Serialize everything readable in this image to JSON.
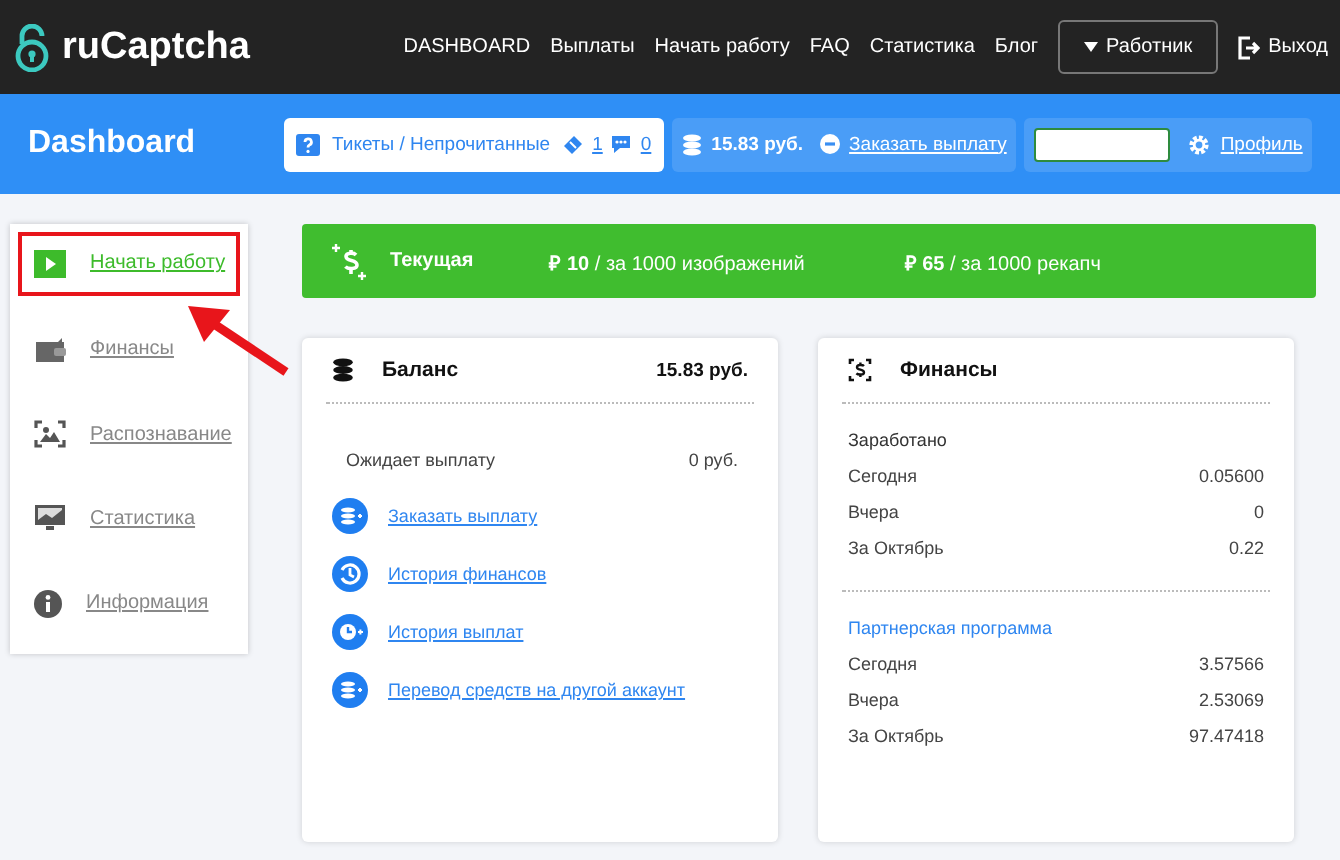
{
  "brand": "ruCaptcha",
  "nav": [
    "DASHBOARD",
    "Выплаты",
    "Начать работу",
    "FAQ",
    "Статистика",
    "Блог"
  ],
  "role_button": "Работник",
  "logout": "Выход",
  "page_title": "Dashboard",
  "tickets": {
    "label": "Тикеты / Непрочитанные",
    "tickets_count": "1",
    "messages_count": "0"
  },
  "balance_box": {
    "amount": "15.83 руб.",
    "link": "Заказать выплату"
  },
  "profile": {
    "link": "Профиль"
  },
  "sidebar": {
    "items": [
      {
        "label": "Начать работу",
        "kind": "play",
        "selected": true
      },
      {
        "label": "Финансы",
        "kind": "wallet",
        "selected": false
      },
      {
        "label": "Распознавание",
        "kind": "recognize",
        "selected": false
      },
      {
        "label": "Статистика",
        "kind": "monitor",
        "selected": false
      },
      {
        "label": "Информация",
        "kind": "info",
        "selected": false
      }
    ]
  },
  "rate_banner": {
    "title": "Текущая",
    "rates": [
      {
        "price": "₽ 10",
        "unit": "/ за 1000 изображений"
      },
      {
        "price": "₽ 65",
        "unit": "/ за 1000 рекапч"
      }
    ]
  },
  "balance_card": {
    "title": "Баланс",
    "amount": "15.83 руб.",
    "pending_label": "Ожидает выплату",
    "pending_value": "0 руб.",
    "links": [
      {
        "label": "Заказать выплату",
        "kind": "coins"
      },
      {
        "label": "История финансов",
        "kind": "history"
      },
      {
        "label": "История выплат",
        "kind": "clock"
      },
      {
        "label": "Перевод средств на другой аккаунт",
        "kind": "coins"
      }
    ]
  },
  "finance_card": {
    "title": "Финансы",
    "sections": [
      {
        "heading": "Заработано",
        "kind": "plain",
        "rows": [
          {
            "label": "Сегодня",
            "value": "0.05600"
          },
          {
            "label": "Вчера",
            "value": "0"
          },
          {
            "label": "За Октябрь",
            "value": "0.22"
          }
        ]
      },
      {
        "heading": "Партнерская программа",
        "kind": "link",
        "rows": [
          {
            "label": "Сегодня",
            "value": "3.57566"
          },
          {
            "label": "Вчера",
            "value": "2.53069"
          },
          {
            "label": "За Октябрь",
            "value": "97.47418"
          }
        ]
      }
    ]
  }
}
